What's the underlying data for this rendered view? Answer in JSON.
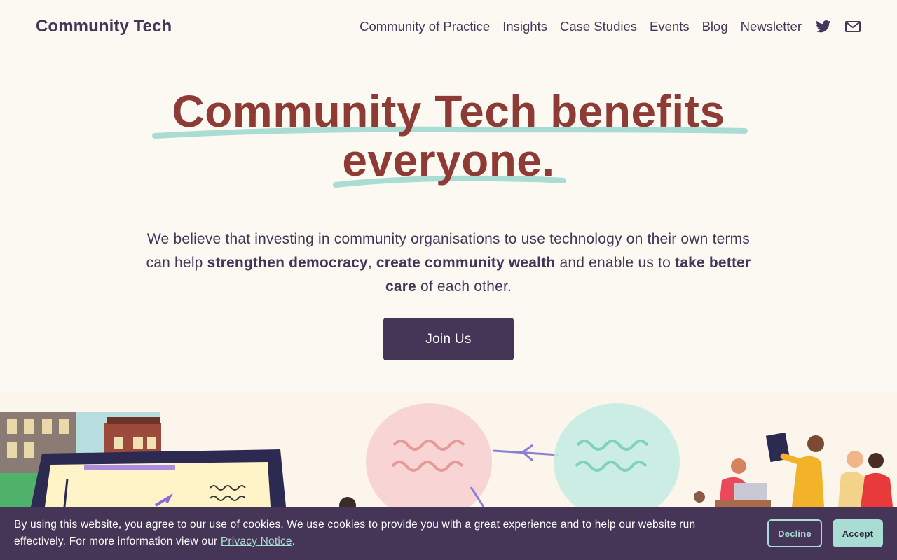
{
  "header": {
    "logo": "Community Tech",
    "nav": [
      {
        "label": "Community of Practice"
      },
      {
        "label": "Insights"
      },
      {
        "label": "Case Studies"
      },
      {
        "label": "Events"
      },
      {
        "label": "Blog"
      },
      {
        "label": "Newsletter"
      }
    ],
    "icons": [
      "twitter-icon",
      "mail-icon"
    ]
  },
  "hero": {
    "title_line1": "Community Tech benefits",
    "title_line2": "everyone.",
    "lead_parts": [
      "We believe that investing in community organisations to use technology on their own terms can help ",
      "strengthen democracy",
      ", ",
      "create community wealth",
      " and enable us to ",
      "take better care",
      " of each other."
    ],
    "cta_label": "Join Us"
  },
  "cookie_banner": {
    "text_before": "By using this website, you agree to our use of cookies. We use cookies to provide you with a great experience and to help our website run effectively. For more information view our ",
    "link_label": "Privacy Notice",
    "text_after": ".",
    "decline_label": "Decline",
    "accept_label": "Accept"
  },
  "colors": {
    "background": "#fcf8f2",
    "primary": "#453557",
    "accent_heading": "#8e3b36",
    "mint": "#a9dcd3"
  }
}
